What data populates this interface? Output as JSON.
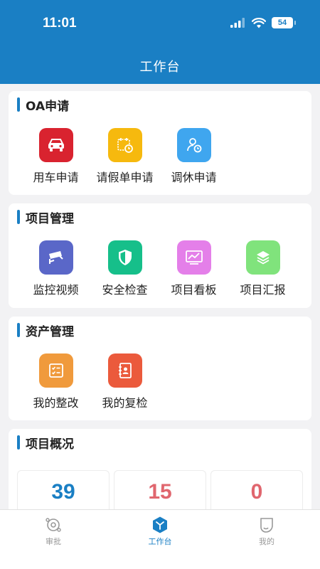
{
  "status": {
    "time": "11:01",
    "battery": "54"
  },
  "header": {
    "title": "工作台"
  },
  "sections": [
    {
      "title": "OA申请",
      "items": [
        {
          "label": "用车申请",
          "icon": "car-icon",
          "color": "#d9232f"
        },
        {
          "label": "请假单申请",
          "icon": "calendar-clock-icon",
          "color": "#f6b90e"
        },
        {
          "label": "调休申请",
          "icon": "user-clock-icon",
          "color": "#3fa6ef"
        }
      ]
    },
    {
      "title": "项目管理",
      "items": [
        {
          "label": "监控视频",
          "icon": "cctv-camera-icon",
          "color": "#5a67c8"
        },
        {
          "label": "安全检查",
          "icon": "shield-check-icon",
          "color": "#16bf8a"
        },
        {
          "label": "项目看板",
          "icon": "chart-board-icon",
          "color": "#e47fe9"
        },
        {
          "label": "项目汇报",
          "icon": "layers-icon",
          "color": "#80e37c"
        }
      ]
    },
    {
      "title": "资产管理",
      "items": [
        {
          "label": "我的整改",
          "icon": "checklist-icon",
          "color": "#f09a3c"
        },
        {
          "label": "我的复检",
          "icon": "contact-book-icon",
          "color": "#eb5a3c"
        }
      ]
    }
  ],
  "overview": {
    "title": "项目概况",
    "stats": [
      {
        "value": "39",
        "color": "#1a7fc4"
      },
      {
        "value": "15",
        "color": "#e0666e"
      },
      {
        "value": "0",
        "color": "#e0666e"
      }
    ]
  },
  "tabbar": {
    "items": [
      {
        "label": "审批",
        "icon": "approval-icon"
      },
      {
        "label": "工作台",
        "icon": "workbench-icon"
      },
      {
        "label": "我的",
        "icon": "profile-icon"
      }
    ],
    "active_color": "#1a7fc4",
    "inactive_color": "#999999"
  }
}
